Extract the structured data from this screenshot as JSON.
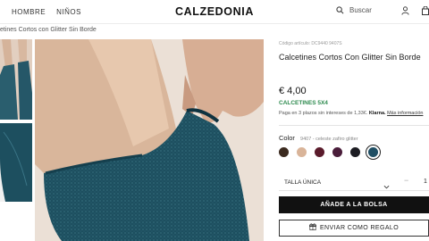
{
  "header": {
    "nav": [
      "HOMBRE",
      "NIÑOS"
    ],
    "logo": "CALZEDONIA",
    "search_label": "Buscar"
  },
  "breadcrumb": "etines Cortos con Glitter Sin Borde",
  "product": {
    "reference": "Código artículo: DC9440 9407S",
    "title": "Calcetines Cortos Con Glitter Sin Borde",
    "price": "€ 4,00",
    "promo": "CALCETINES 5X4",
    "klarna_text": "Paga en 3 plazos sin intereses de 1,33€.",
    "klarna_brand": "Klarna.",
    "klarna_link": "Más información",
    "color_label": "Color",
    "color_code": "9407 - celeste zafiro glitter",
    "swatches": [
      {
        "name": "marron-oscuro",
        "color": "#3b2a1f"
      },
      {
        "name": "beige",
        "color": "#d9b499"
      },
      {
        "name": "burdeos",
        "color": "#5a1b2b"
      },
      {
        "name": "ciruela",
        "color": "#4a1d3a"
      },
      {
        "name": "negro",
        "color": "#1c1c22"
      },
      {
        "name": "celeste-zafiro-glitter",
        "color": "#1f4e63",
        "selected": true
      }
    ],
    "size_label": "TALLA ÚNICA",
    "quantity_minus": "−",
    "quantity": "1",
    "add_button": "AÑADE A LA BOLSA",
    "gift_button": "ENVIAR COMO REGALO"
  },
  "colors": {
    "accent_green": "#2d8a4e",
    "button_dark": "#111111",
    "sock_teal": "#1d4f5f"
  }
}
